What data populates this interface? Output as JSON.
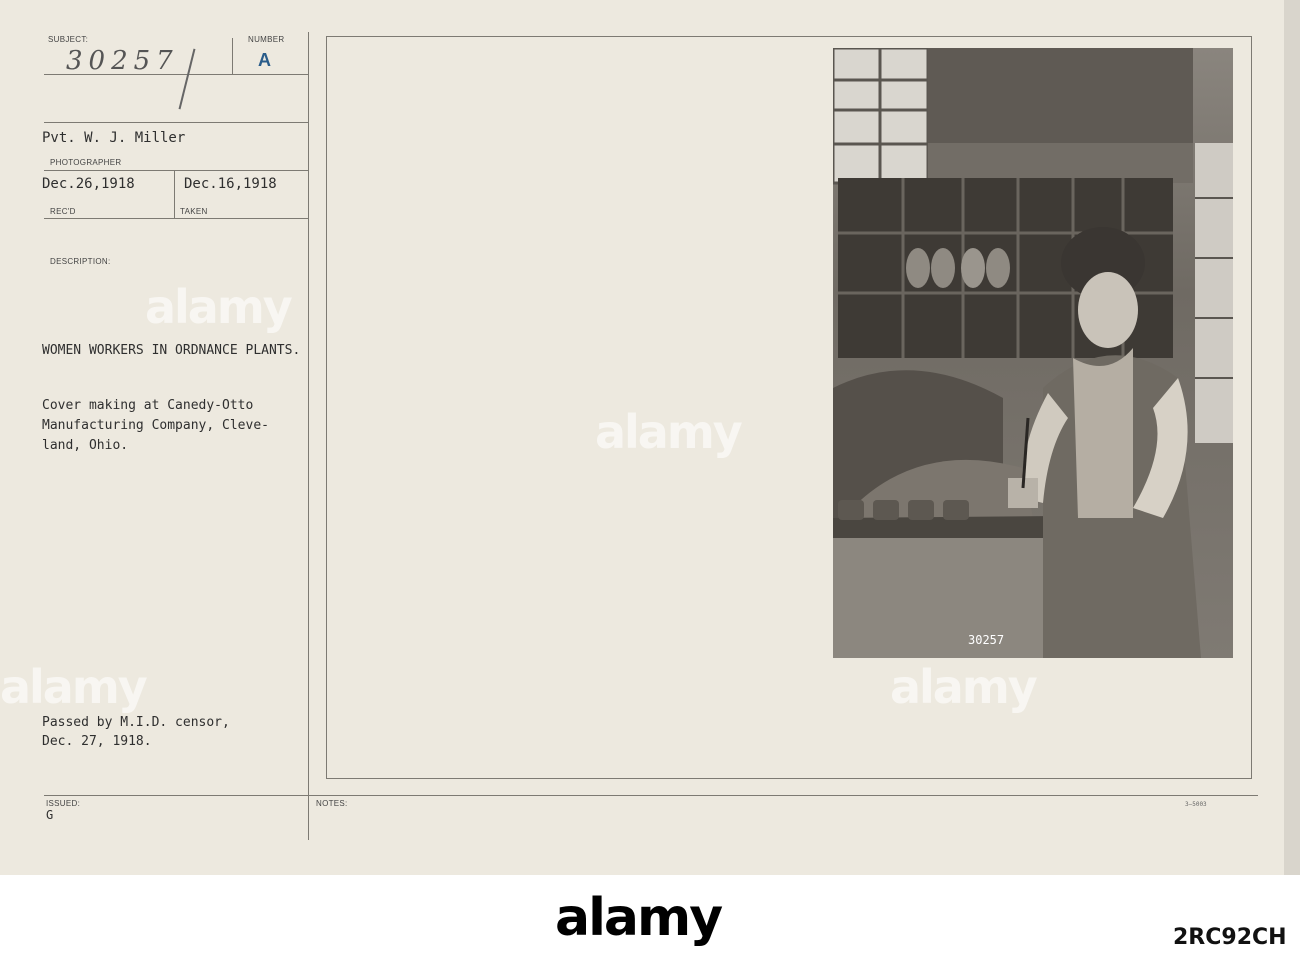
{
  "card": {
    "subject_label": "SUBJECT:",
    "subject_number": "30257",
    "number_label": "NUMBER",
    "number_value": "A",
    "photographer_name": "Pvt. W. J. Miller",
    "photographer_label": "PHOTOGRAPHER",
    "recd_date": "Dec.26,1918",
    "recd_label": "REC'D",
    "taken_date": "Dec.16,1918",
    "taken_label": "TAKEN",
    "description_label": "DESCRIPTION:",
    "description_title": "WOMEN WORKERS IN ORDNANCE PLANTS.",
    "description_line1": "Cover making at Canedy-Otto",
    "description_line2": "Manufacturing Company, Cleve-",
    "description_line3": "land, Ohio.",
    "censor_line1": "Passed by M.I.D. censor,",
    "censor_line2": "Dec. 27, 1918.",
    "issued_label": "ISSUED:",
    "issued_value": "G",
    "notes_label": "NOTES:",
    "form_code": "3—5003"
  },
  "photo": {
    "negative_number": "30257"
  },
  "watermark": {
    "text": "alamy"
  },
  "footer": {
    "logo": "alamy",
    "image_id": "2RC92CH"
  },
  "colors": {
    "card": "#ede9df",
    "ink": "#2f2f2f",
    "number_stamp": "#2a5c8a"
  }
}
